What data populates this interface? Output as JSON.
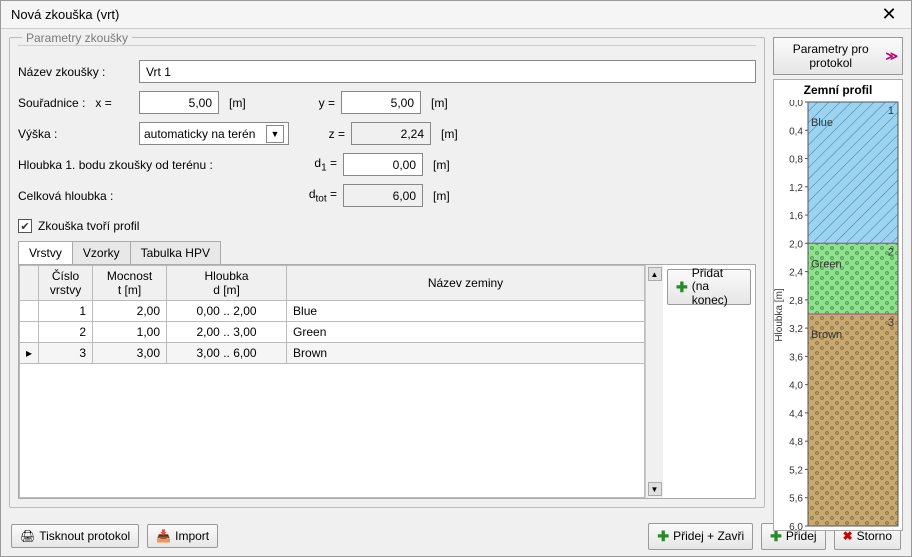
{
  "title": "Nová zkouška (vrt)",
  "group_title": "Parametry zkoušky",
  "labels": {
    "name": "Název zkoušky :",
    "coords": "Souřadnice :",
    "x": "x =",
    "y": "y =",
    "height": "Výška :",
    "z": "z =",
    "depth_first": "Hloubka 1. bodu zkoušky od terénu :",
    "d1": "d₁ =",
    "total_depth": "Celková hloubka :",
    "dtot": "dₜₒₜ =",
    "unit_m": "[m]",
    "profile_checkbox": "Zkouška tvoří profil"
  },
  "values": {
    "name": "Vrt 1",
    "x": "5,00",
    "y": "5,00",
    "z": "2,24",
    "d1": "0,00",
    "dtot": "6,00",
    "height_mode": "automaticky na terén"
  },
  "tabs": {
    "t0": "Vrstvy",
    "t1": "Vzorky",
    "t2": "Tabulka HPV"
  },
  "table": {
    "headers": {
      "col0": "Číslo\nvrstvy",
      "col1": "Mocnost\nt [m]",
      "col2": "Hloubka\nd [m]",
      "col3": "Název zeminy"
    },
    "rows": [
      {
        "n": "1",
        "t": "2,00",
        "d": "0,00 .. 2,00",
        "name": "Blue"
      },
      {
        "n": "2",
        "t": "1,00",
        "d": "2,00 .. 3,00",
        "name": "Green"
      },
      {
        "n": "3",
        "t": "3,00",
        "d": "3,00 .. 6,00",
        "name": "Brown"
      }
    ]
  },
  "buttons": {
    "add_end": "Přidat\n(na konec)",
    "protocol_params": "Parametry pro protokol",
    "print_protocol": "Tisknout protokol",
    "import": "Import",
    "add_close": "Přidej + Zavři",
    "add": "Přidej",
    "cancel": "Storno"
  },
  "profile": {
    "title": "Zemní profil",
    "axis_label": "Hloubka [m]",
    "ticks": [
      "0,0",
      "0,4",
      "0,8",
      "1,2",
      "1,6",
      "2,0",
      "2,4",
      "2,8",
      "3,2",
      "3,6",
      "4,0",
      "4,4",
      "4,8",
      "5,2",
      "5,6",
      "6,0"
    ],
    "layers": [
      {
        "n": "1",
        "name": "Blue",
        "from": 0,
        "to": 2,
        "fill": "#9cd3f0",
        "hatch": "diag"
      },
      {
        "n": "2",
        "name": "Green",
        "from": 2,
        "to": 3,
        "fill": "#8fe08f",
        "hatch": "dots"
      },
      {
        "n": "3",
        "name": "Brown",
        "from": 3,
        "to": 6,
        "fill": "#c9a972",
        "hatch": "dots"
      }
    ]
  }
}
